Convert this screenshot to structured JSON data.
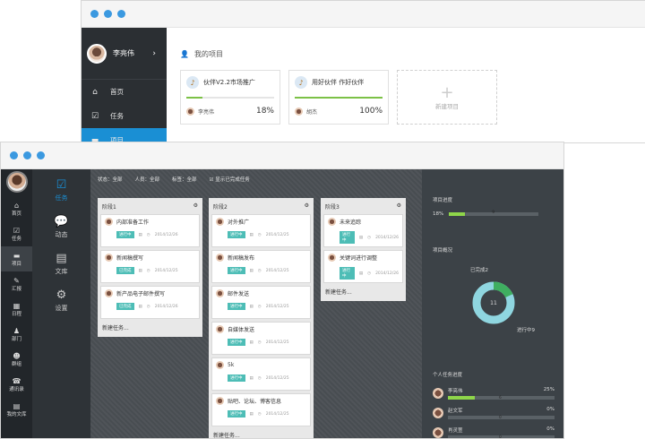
{
  "window1": {
    "sidebar": {
      "user_name": "李亮伟",
      "chevron": "›",
      "items": [
        {
          "icon": "home-icon",
          "label": "首页"
        },
        {
          "icon": "task-icon",
          "label": "任务"
        },
        {
          "icon": "project-icon",
          "label": "项目"
        }
      ]
    },
    "section_title": "我的项目",
    "projects": [
      {
        "name": "伙伴V2.2市场推广",
        "owner": "李亮伟",
        "progress_pct": 18,
        "progress_label": "18%"
      },
      {
        "name": "用好伙伴 作好伙伴",
        "owner": "胡杰",
        "progress_pct": 100,
        "progress_label": "100%"
      }
    ],
    "add_project_label": "新建项目",
    "add_project_plus": "+"
  },
  "window2": {
    "sidebar": [
      {
        "icon": "home-icon",
        "label": "首页"
      },
      {
        "icon": "task-icon",
        "label": "任务"
      },
      {
        "icon": "project-icon",
        "label": "项目"
      },
      {
        "icon": "report-icon",
        "label": "汇报"
      },
      {
        "icon": "calendar-icon",
        "label": "日程"
      },
      {
        "icon": "department-icon",
        "label": "部门"
      },
      {
        "icon": "group-icon",
        "label": "群组"
      },
      {
        "icon": "contacts-icon",
        "label": "通讯录"
      },
      {
        "icon": "docs-icon",
        "label": "我的文库"
      }
    ],
    "subnav": [
      {
        "icon": "task-icon",
        "label": "任务"
      },
      {
        "icon": "chat-icon",
        "label": "动态"
      },
      {
        "icon": "library-icon",
        "label": "文库"
      },
      {
        "icon": "gear-icon",
        "label": "设置"
      }
    ],
    "filters": {
      "status": "状态：全部",
      "people": "人员：全部",
      "tag": "标签：全部",
      "show_done": "显示已完成任务"
    },
    "columns": [
      {
        "title": "阶段1",
        "new_task": "新建任务...",
        "tasks": [
          {
            "name": "内部准备工作",
            "tag": "进行中",
            "date": "2014/12/26"
          },
          {
            "name": "新闻稿撰写",
            "tag": "已完成",
            "date": "2014/12/25"
          },
          {
            "name": "新产品电子邮件撰写",
            "tag": "已完成",
            "date": "2014/12/26"
          }
        ]
      },
      {
        "title": "阶段2",
        "new_task": "新建任务...",
        "tasks": [
          {
            "name": "对外推广",
            "tag": "进行中",
            "date": "2014/12/25"
          },
          {
            "name": "新闻稿发布",
            "tag": "进行中",
            "date": "2014/12/25"
          },
          {
            "name": "邮件发送",
            "tag": "进行中",
            "date": "2014/12/25"
          },
          {
            "name": "自媒体发送",
            "tag": "进行中",
            "date": "2014/12/25"
          },
          {
            "name": "5k",
            "tag": "进行中",
            "date": "2014/12/25"
          },
          {
            "name": "贴吧、论坛、博客信息",
            "tag": "进行中",
            "date": "2014/12/25"
          }
        ]
      },
      {
        "title": "阶段3",
        "new_task": "新建任务...",
        "tasks": [
          {
            "name": "未来追踪",
            "tag": "进行中",
            "date": "2014/12/26"
          },
          {
            "name": "关键词进行调整",
            "tag": "进行中",
            "date": "2014/12/26"
          }
        ]
      }
    ],
    "right_panel": {
      "progress_title": "项目进度",
      "progress_label": "18%",
      "progress_pct": 18,
      "progress_count": "9",
      "overview_title": "项目概况",
      "done_label": "已完成2",
      "doing_label": "进行中9",
      "center_value": "11",
      "done_count": 2,
      "doing_count": 9,
      "personal_title": "个人任务进度",
      "people": [
        {
          "name": "李亮伟",
          "count": "6",
          "pct_label": "25%",
          "pct": 25
        },
        {
          "name": "赵文军",
          "count": "0",
          "pct_label": "0%",
          "pct": 0
        },
        {
          "name": "肖灵萱",
          "count": "0",
          "pct_label": "0%",
          "pct": 0
        }
      ]
    }
  },
  "colors": {
    "accent": "#1a8fd4",
    "green": "#7cc146",
    "teal": "#4dbdb6"
  }
}
